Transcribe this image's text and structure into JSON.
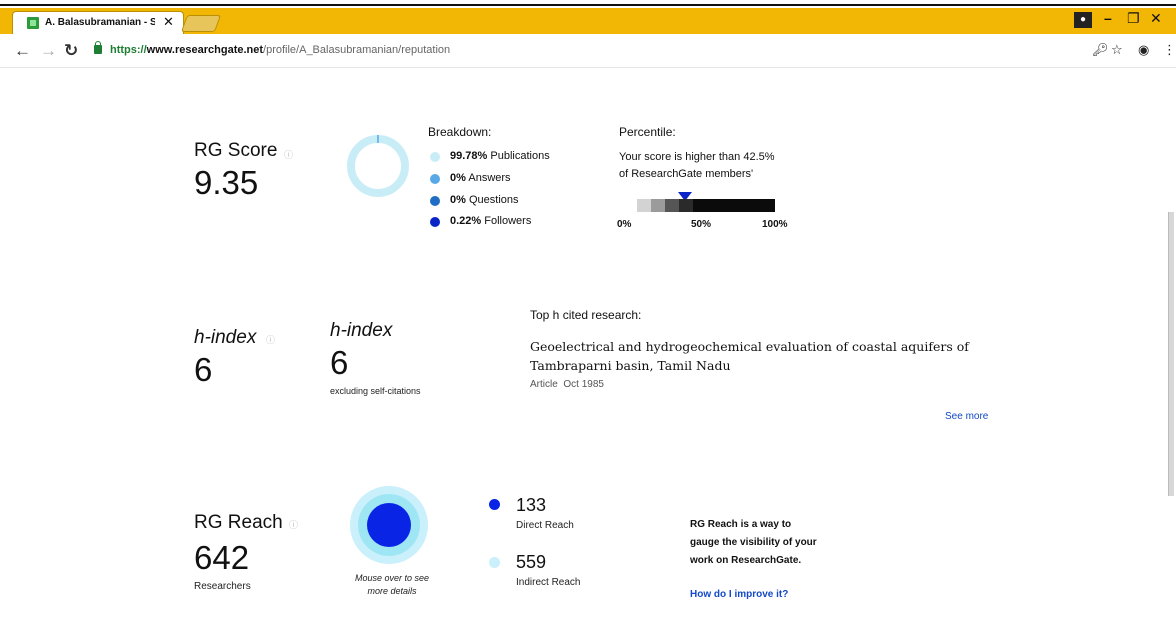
{
  "browser": {
    "tab_title": "A. Balasubramanian - Sc",
    "tab_close": "✕",
    "url_scheme": "https://",
    "url_host": "www.researchgate.net",
    "url_path": "/profile/A_Balasubramanian/reputation",
    "window_controls": {
      "minimize": "–",
      "restore": "❐",
      "close": "✕"
    },
    "colors": {
      "tab_strip": "#f2b705"
    }
  },
  "rg_score": {
    "title": "RG Score",
    "value": "9.35",
    "breakdown_title": "Breakdown:",
    "breakdown": [
      {
        "pct": "99.78%",
        "label": "Publications",
        "color": "#c9edf7"
      },
      {
        "pct": "0%",
        "label": "Answers",
        "color": "#5aa9e6"
      },
      {
        "pct": "0%",
        "label": "Questions",
        "color": "#1f6ec4"
      },
      {
        "pct": "0.22%",
        "label": "Followers",
        "color": "#0a24c6"
      }
    ],
    "percentile_title": "Percentile:",
    "percentile_text_1": "Your score is higher than 42.5%",
    "percentile_text_2": "of ResearchGate members'",
    "percentile_value": 42.5,
    "percentile_ticks": [
      "0%",
      "50%",
      "100%"
    ]
  },
  "h_index": {
    "title": "h-index",
    "value": "6",
    "excl_title": "h-index",
    "excl_value": "6",
    "excl_note": "excluding self-citations",
    "top_cited_label": "Top h cited research:",
    "paper_title_1": "Geoelectrical and hydrogeochemical evaluation of coastal aquifers of",
    "paper_title_2": "Tambraparni basin, Tamil Nadu",
    "paper_type": "Article",
    "paper_date": "Oct 1985",
    "see_more": "See more"
  },
  "rg_reach": {
    "title": "RG Reach",
    "value": "642",
    "unit": "Researchers",
    "hint_1": "Mouse over to see",
    "hint_2": "more details",
    "direct_value": "133",
    "direct_label": "Direct Reach",
    "indirect_value": "559",
    "indirect_label": "Indirect Reach",
    "desc_bold": "RG Reach",
    "desc_1": " is a way to",
    "desc_2": "gauge the visibility of your",
    "desc_3": "work on ResearchGate.",
    "improve_link": "How do I improve it?",
    "colors": {
      "direct": "#0a24e6",
      "indirect": "#c9f0fb"
    }
  }
}
